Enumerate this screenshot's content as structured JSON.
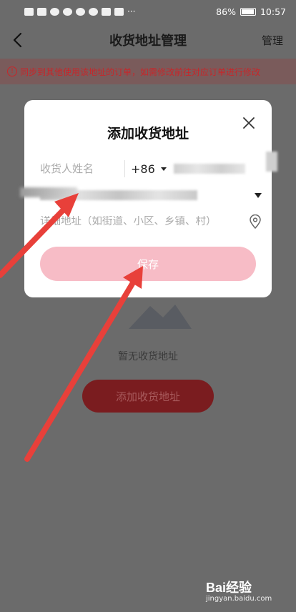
{
  "status_bar": {
    "battery": "86%",
    "time": "10:57"
  },
  "nav": {
    "title": "收货地址管理",
    "manage": "管理"
  },
  "notice": {
    "text": "同步到其他使用该地址的订单，如需修改前往对应订单进行修改"
  },
  "dialog": {
    "title": "添加收货地址",
    "name_placeholder": "收货人姓名",
    "country_code": "+86",
    "detail_placeholder": "详细地址（如街道、小区、乡镇、村）",
    "save_label": "保存"
  },
  "empty": {
    "text": "暂无收货地址",
    "add_button": "添加收货地址"
  },
  "watermark": {
    "brand": "Bai经验",
    "url": "jingyan.baidu.com"
  },
  "colors": {
    "save_button": "#f7bcc6",
    "add_button": "#7a1c1f",
    "arrow": "#e8403a"
  }
}
